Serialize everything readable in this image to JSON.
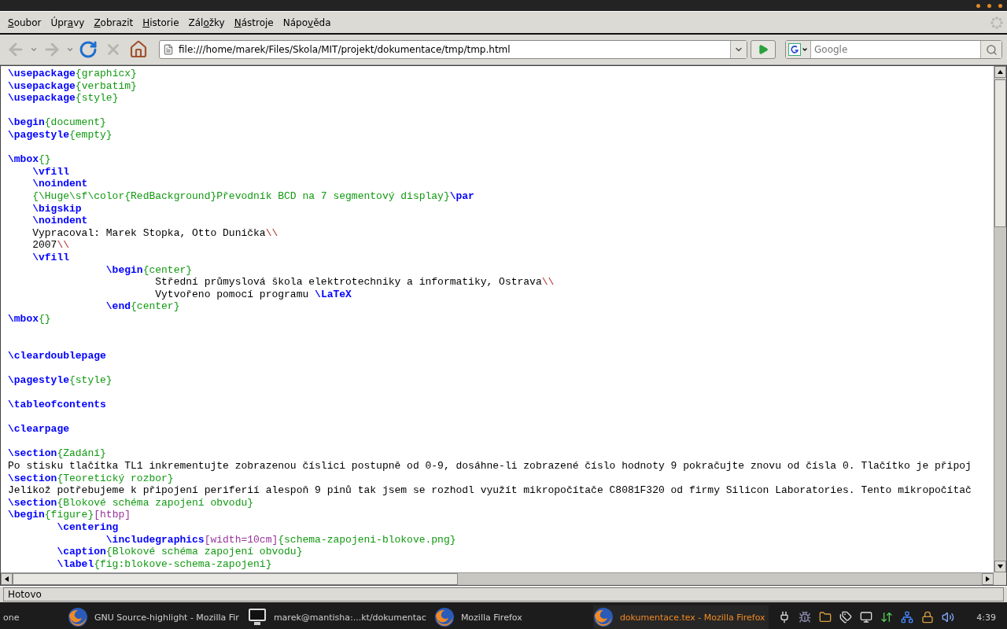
{
  "menu_bar": {
    "items": [
      {
        "key": "S",
        "after": "oubor"
      },
      {
        "before": "Úpr",
        "key": "a",
        "after": "vy"
      },
      {
        "key": "Z",
        "after": "obrazit"
      },
      {
        "key": "H",
        "after": "istorie"
      },
      {
        "before": "Zál",
        "key": "o",
        "after": "žky"
      },
      {
        "key": "N",
        "after": "ástroje"
      },
      {
        "before": "Nápo",
        "key": "v",
        "after": "ěda"
      }
    ]
  },
  "toolbar": {
    "buttons": [
      {
        "kind": "back",
        "disabled": true
      },
      {
        "kind": "history",
        "disabled": true
      },
      {
        "kind": "forward",
        "disabled": true
      },
      {
        "kind": "history",
        "disabled": true
      },
      {
        "kind": "reload",
        "disabled": false
      },
      {
        "kind": "stop",
        "disabled": true
      },
      {
        "kind": "home",
        "disabled": false
      }
    ],
    "url": "file:///home/marek/Files/Skola/MIT/projekt/dokumentace/tmp/tmp.html",
    "search": {
      "placeholder": "Google"
    }
  },
  "code": [
    {
      "kind": "code",
      "tokens": [
        {
          "kind": "cmd",
          "text": "\\usepackage"
        },
        {
          "kind": "arg",
          "text": "{graphicx}"
        }
      ]
    },
    {
      "kind": "code",
      "tokens": [
        {
          "kind": "cmd",
          "text": "\\usepackage"
        },
        {
          "kind": "arg",
          "text": "{verbatim}"
        }
      ]
    },
    {
      "kind": "code",
      "tokens": [
        {
          "kind": "cmd",
          "text": "\\usepackage"
        },
        {
          "kind": "arg",
          "text": "{style}"
        }
      ]
    },
    {
      "kind": "blank"
    },
    {
      "kind": "code",
      "tokens": [
        {
          "kind": "cmd",
          "text": "\\begin"
        },
        {
          "kind": "arg",
          "text": "{document}"
        }
      ]
    },
    {
      "kind": "code",
      "tokens": [
        {
          "kind": "cmd",
          "text": "\\pagestyle"
        },
        {
          "kind": "arg",
          "text": "{empty}"
        }
      ]
    },
    {
      "kind": "blank"
    },
    {
      "kind": "code",
      "tokens": [
        {
          "kind": "cmd",
          "text": "\\mbox"
        },
        {
          "kind": "arg",
          "text": "{}"
        }
      ]
    },
    {
      "kind": "code",
      "tokens": [
        {
          "kind": "cmd",
          "text": "    \\vfill"
        }
      ]
    },
    {
      "kind": "code",
      "tokens": [
        {
          "kind": "cmd",
          "text": "    \\noindent"
        }
      ]
    },
    {
      "kind": "code",
      "tokens": [
        {
          "kind": "arg",
          "text": "    {\\Huge\\sf\\color{RedBackground}Převodník BCD na 7 segmentový display}"
        },
        {
          "kind": "cmd",
          "text": "\\par"
        }
      ]
    },
    {
      "kind": "code",
      "tokens": [
        {
          "kind": "cmd",
          "text": "    \\bigskip"
        }
      ]
    },
    {
      "kind": "code",
      "tokens": [
        {
          "kind": "cmd",
          "text": "    \\noindent"
        }
      ]
    },
    {
      "kind": "code",
      "tokens": [
        {
          "kind": "text",
          "text": "    Vypracoval: Marek Stopka, Otto Dunička"
        },
        {
          "kind": "break",
          "text": "\\\\"
        }
      ]
    },
    {
      "kind": "code",
      "tokens": [
        {
          "kind": "text",
          "text": "    2007"
        },
        {
          "kind": "break",
          "text": "\\\\"
        }
      ]
    },
    {
      "kind": "code",
      "tokens": [
        {
          "kind": "cmd",
          "text": "    \\vfill"
        }
      ]
    },
    {
      "kind": "code",
      "tokens": [
        {
          "kind": "cmd",
          "text": "                \\begin"
        },
        {
          "kind": "arg",
          "text": "{center}"
        }
      ]
    },
    {
      "kind": "code",
      "tokens": [
        {
          "kind": "text",
          "text": "                        Střední průmyslová škola elektrotechniky a informatiky, Ostrava"
        },
        {
          "kind": "break",
          "text": "\\\\"
        }
      ]
    },
    {
      "kind": "code",
      "tokens": [
        {
          "kind": "text",
          "text": "                        Vytvořeno pomocí programu "
        },
        {
          "kind": "cmd",
          "text": "\\LaTeX"
        }
      ]
    },
    {
      "kind": "code",
      "tokens": [
        {
          "kind": "cmd",
          "text": "                \\end"
        },
        {
          "kind": "arg",
          "text": "{center}"
        }
      ]
    },
    {
      "kind": "code",
      "tokens": [
        {
          "kind": "cmd",
          "text": "\\mbox"
        },
        {
          "kind": "arg",
          "text": "{}"
        }
      ]
    },
    {
      "kind": "blank"
    },
    {
      "kind": "blank"
    },
    {
      "kind": "code",
      "tokens": [
        {
          "kind": "cmd",
          "text": "\\cleardoublepage"
        }
      ]
    },
    {
      "kind": "blank"
    },
    {
      "kind": "code",
      "tokens": [
        {
          "kind": "cmd",
          "text": "\\pagestyle"
        },
        {
          "kind": "arg",
          "text": "{style}"
        }
      ]
    },
    {
      "kind": "blank"
    },
    {
      "kind": "code",
      "tokens": [
        {
          "kind": "cmd",
          "text": "\\tableofcontents"
        }
      ]
    },
    {
      "kind": "blank"
    },
    {
      "kind": "code",
      "tokens": [
        {
          "kind": "cmd",
          "text": "\\clearpage"
        }
      ]
    },
    {
      "kind": "blank"
    },
    {
      "kind": "code",
      "tokens": [
        {
          "kind": "cmd",
          "text": "\\section"
        },
        {
          "kind": "arg",
          "text": "{Zadání}"
        }
      ]
    },
    {
      "kind": "code",
      "tokens": [
        {
          "kind": "text",
          "text": "Po stisku tlačítka TL1 inkrementujte zobrazenou číslici postupně od 0-9, dosáhne-li zobrazené číslo hodnoty 9 pokračujte znovu od čísla 0. Tlačítko je připoj"
        }
      ]
    },
    {
      "kind": "code",
      "tokens": [
        {
          "kind": "cmd",
          "text": "\\section"
        },
        {
          "kind": "arg",
          "text": "{Teoretický rozbor}"
        }
      ]
    },
    {
      "kind": "code",
      "tokens": [
        {
          "kind": "text",
          "text": "Jelikož potřebujeme k připojení periferií alespoň 9 pinů tak jsem se rozhodl využít mikropočítače C8081F320 od firmy Silicon Laboratories. Tento mikropočítač"
        }
      ]
    },
    {
      "kind": "code",
      "tokens": [
        {
          "kind": "cmd",
          "text": "\\section"
        },
        {
          "kind": "arg",
          "text": "{Blokové schéma zapojení obvodu}"
        }
      ]
    },
    {
      "kind": "code",
      "tokens": [
        {
          "kind": "cmd",
          "text": "\\begin"
        },
        {
          "kind": "arg",
          "text": "{figure}"
        },
        {
          "kind": "opt",
          "text": "[htbp]"
        }
      ]
    },
    {
      "kind": "code",
      "tokens": [
        {
          "kind": "cmd",
          "text": "        \\centering"
        }
      ]
    },
    {
      "kind": "code",
      "tokens": [
        {
          "kind": "cmd",
          "text": "                \\includegraphics"
        },
        {
          "kind": "opt",
          "text": "[width=10cm]"
        },
        {
          "kind": "arg",
          "text": "{schema-zapojeni-blokove.png}"
        }
      ]
    },
    {
      "kind": "code",
      "tokens": [
        {
          "kind": "cmd",
          "text": "        \\caption"
        },
        {
          "kind": "arg",
          "text": "{Blokové schéma zapojení obvodu}"
        }
      ]
    },
    {
      "kind": "code",
      "tokens": [
        {
          "kind": "cmd",
          "text": "        \\label"
        },
        {
          "kind": "arg",
          "text": "{fig:blokove-schema-zapojeni}"
        }
      ]
    }
  ],
  "status_bar": {
    "text": "Hotovo"
  },
  "taskbar": {
    "label": "one",
    "tasks": [
      {
        "kind": "browser",
        "title": "GNU Source-highlight - Mozilla Fir",
        "selected": false
      },
      {
        "kind": "terminal",
        "title": "marek@mantisha:...kt/dokumentac",
        "selected": false
      },
      {
        "kind": "browser",
        "title": "Mozilla Firefox",
        "selected": false
      },
      {
        "kind": "browser",
        "title": "dokumentace.tex - Mozilla Firefox",
        "selected": true
      }
    ],
    "clock": "4:39"
  }
}
